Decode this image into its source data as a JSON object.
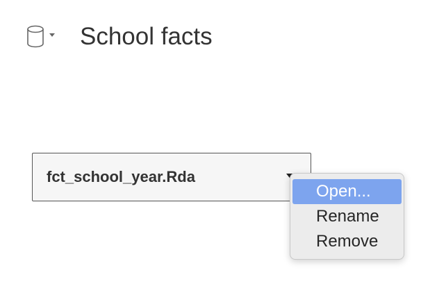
{
  "datasource": {
    "icon": "database-icon",
    "title": "School facts"
  },
  "table": {
    "name": "fct_school_year.Rda",
    "caret_icon": "caret-down-icon"
  },
  "context_menu": {
    "highlight_color": "#7da4ee",
    "items": [
      {
        "label": "Open...",
        "active": true
      },
      {
        "label": "Rename",
        "active": false
      },
      {
        "label": "Remove",
        "active": false
      }
    ]
  }
}
